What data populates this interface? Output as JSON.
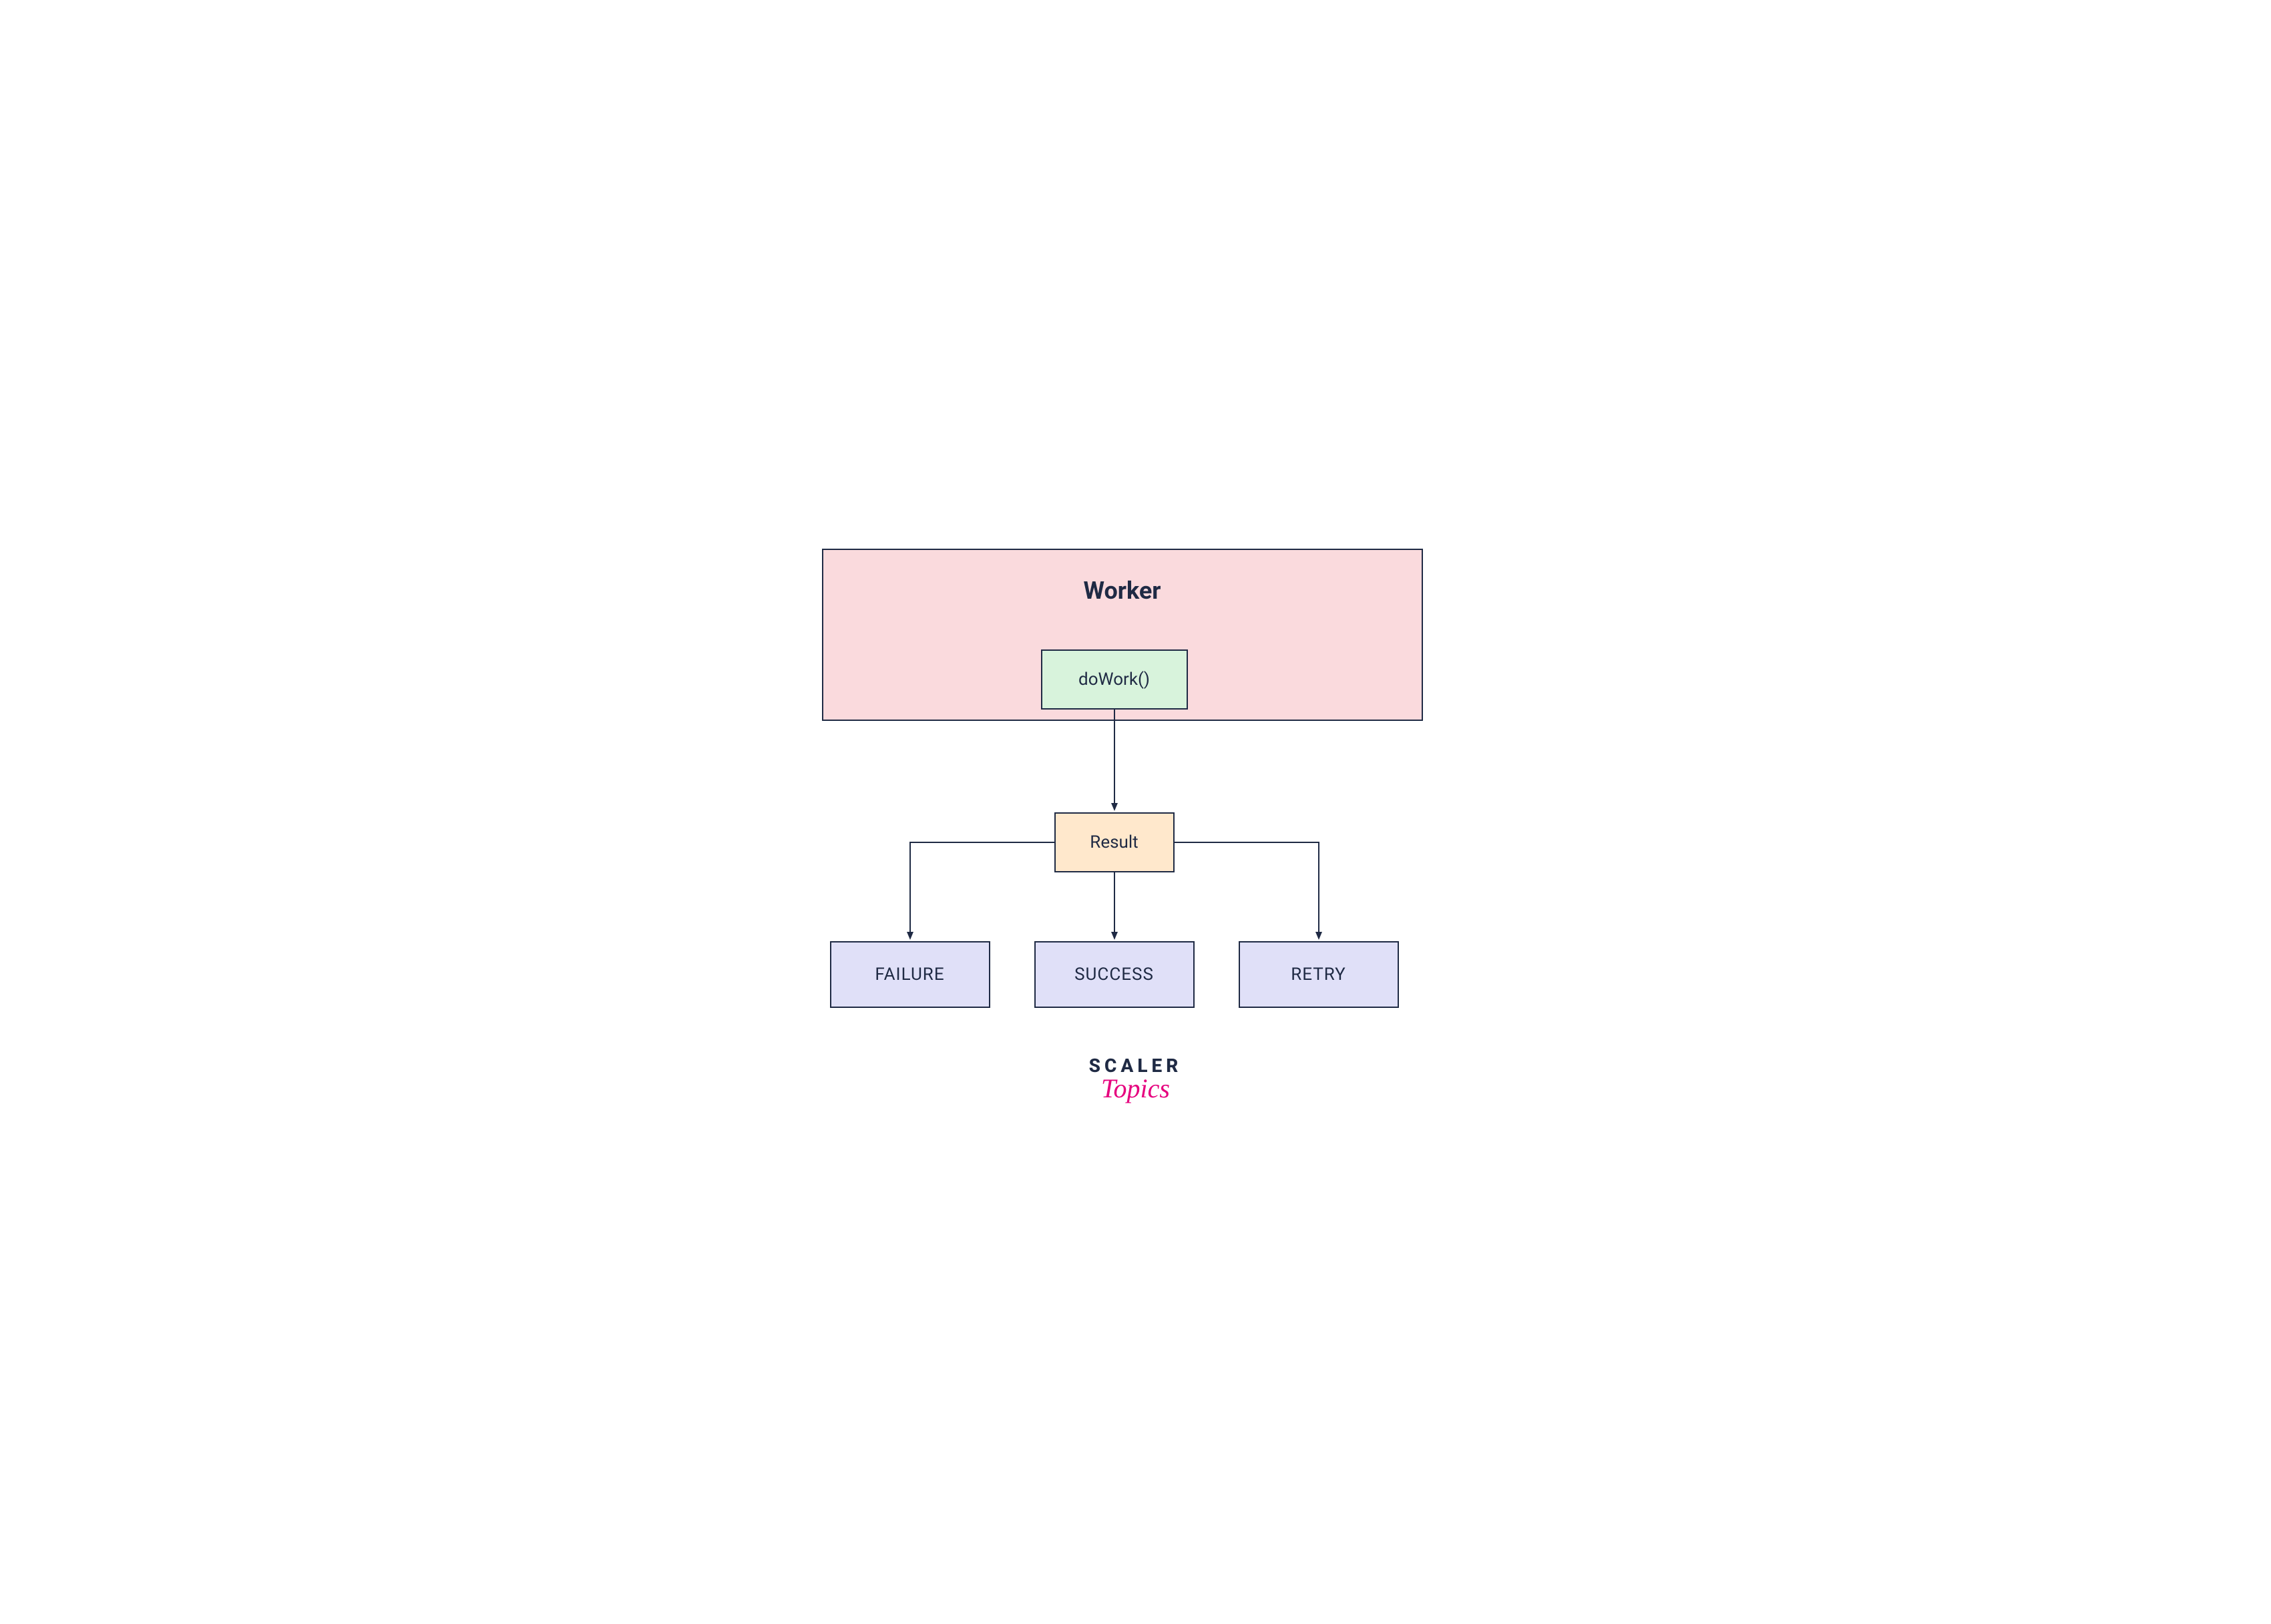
{
  "diagram": {
    "worker_title": "Worker",
    "dowork_label": "doWork()",
    "result_label": "Result",
    "outcomes": {
      "failure": "FAILURE",
      "success": "SUCCESS",
      "retry": "RETRY"
    }
  },
  "branding": {
    "line1": "SCALER",
    "line2": "Topics"
  },
  "colors": {
    "worker_bg": "#fadadd",
    "dowork_bg": "#d8f3dc",
    "result_bg": "#ffe8cc",
    "outcome_bg": "#e0e0f8",
    "border": "#1f2a44",
    "brand_accent": "#e6007e"
  }
}
